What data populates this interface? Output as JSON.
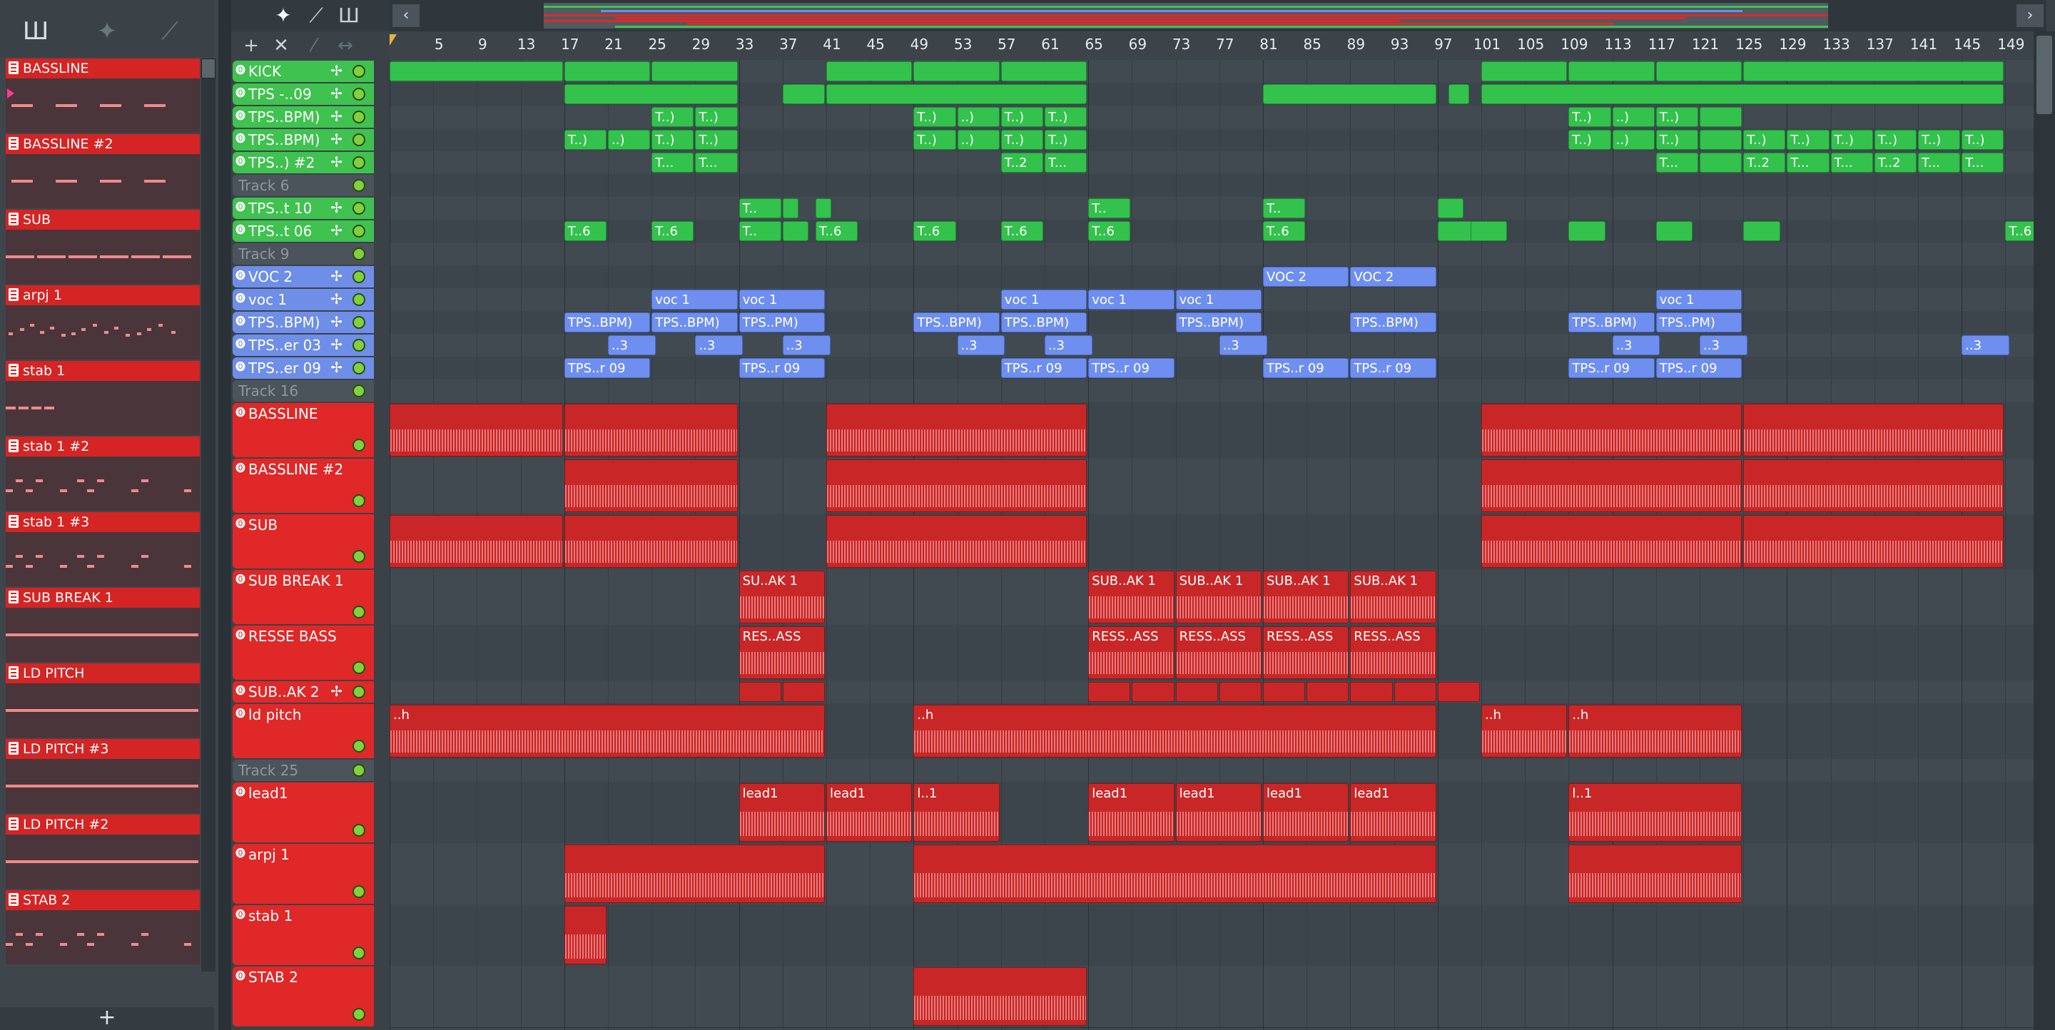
{
  "clip_panel": {
    "clips": [
      {
        "label": "BASSLINE",
        "pattern": "dash-long"
      },
      {
        "label": "BASSLINE #2",
        "pattern": "dash-long"
      },
      {
        "label": "SUB",
        "pattern": "dash-full"
      },
      {
        "label": "arpj 1",
        "pattern": "dots"
      },
      {
        "label": "stab 1",
        "pattern": "dash-short"
      },
      {
        "label": "stab 1 #2",
        "pattern": "dash-mixed"
      },
      {
        "label": "stab 1 #3",
        "pattern": "dash-mixed"
      },
      {
        "label": "SUB BREAK 1",
        "pattern": "line"
      },
      {
        "label": "LD PITCH",
        "pattern": "line"
      },
      {
        "label": "LD PITCH #3",
        "pattern": "line"
      },
      {
        "label": "LD PITCH #2",
        "pattern": "line"
      },
      {
        "label": "STAB 2",
        "pattern": "dash-mixed"
      }
    ],
    "add_label": "+"
  },
  "toolbar": {
    "add": "+",
    "close": "✕"
  },
  "ruler": {
    "bars": [
      "5",
      "9",
      "13",
      "17",
      "21",
      "25",
      "29",
      "33",
      "37",
      "41",
      "45",
      "49",
      "53",
      "57",
      "61",
      "65",
      "69",
      "73",
      "77",
      "81",
      "85",
      "89",
      "93",
      "97",
      "101",
      "105",
      "109",
      "113",
      "117",
      "121",
      "125",
      "129",
      "133",
      "137",
      "141",
      "145",
      "149"
    ]
  },
  "tracks": [
    {
      "label": "KICK",
      "color": "green",
      "h": 32
    },
    {
      "label": "TPS -..09",
      "color": "green",
      "h": 32
    },
    {
      "label": "TPS..BPM)",
      "color": "green",
      "h": 32
    },
    {
      "label": "TPS..BPM)",
      "color": "green",
      "h": 32
    },
    {
      "label": "TPS..) #2",
      "color": "green",
      "h": 32
    },
    {
      "label": "Track 6",
      "color": "empty",
      "h": 32
    },
    {
      "label": "TPS..t 10",
      "color": "green",
      "h": 32
    },
    {
      "label": "TPS..t 06",
      "color": "green",
      "h": 32
    },
    {
      "label": "Track 9",
      "color": "empty",
      "h": 32
    },
    {
      "label": "VOC 2",
      "color": "blue",
      "h": 32
    },
    {
      "label": "voc 1",
      "color": "blue",
      "h": 32
    },
    {
      "label": "TPS..BPM)",
      "color": "blue",
      "h": 32
    },
    {
      "label": "TPS..er 03",
      "color": "blue",
      "h": 32
    },
    {
      "label": "TPS..er 09",
      "color": "blue",
      "h": 32
    },
    {
      "label": "Track 16",
      "color": "empty",
      "h": 32
    },
    {
      "label": "BASSLINE",
      "color": "red",
      "h": 78
    },
    {
      "label": "BASSLINE #2",
      "color": "red",
      "h": 78
    },
    {
      "label": "SUB",
      "color": "red",
      "h": 78
    },
    {
      "label": "SUB BREAK 1",
      "color": "red",
      "h": 78
    },
    {
      "label": "RESSE BASS",
      "color": "red",
      "h": 78
    },
    {
      "label": "SUB..AK 2",
      "color": "red",
      "h": 32
    },
    {
      "label": "ld pitch",
      "color": "red",
      "h": 78
    },
    {
      "label": "Track 25",
      "color": "empty",
      "h": 32
    },
    {
      "label": "lead1",
      "color": "red",
      "h": 86
    },
    {
      "label": "arpj 1",
      "color": "red",
      "h": 86
    },
    {
      "label": "stab 1",
      "color": "red",
      "h": 86
    },
    {
      "label": "STAB 2",
      "color": "red",
      "h": 86
    }
  ],
  "clips": [
    {
      "row": 0,
      "s": 1,
      "e": 16,
      "c": "g",
      "t": ""
    },
    {
      "row": 0,
      "s": 17,
      "e": 24,
      "c": "g",
      "t": ""
    },
    {
      "row": 0,
      "s": 25,
      "e": 32,
      "c": "g",
      "t": ""
    },
    {
      "row": 0,
      "s": 41,
      "e": 48,
      "c": "g",
      "t": ""
    },
    {
      "row": 0,
      "s": 49,
      "e": 56,
      "c": "g",
      "t": ""
    },
    {
      "row": 0,
      "s": 57,
      "e": 64,
      "c": "g",
      "t": ""
    },
    {
      "row": 0,
      "s": 101,
      "e": 108,
      "c": "g",
      "t": ""
    },
    {
      "row": 0,
      "s": 109,
      "e": 116,
      "c": "g",
      "t": ""
    },
    {
      "row": 0,
      "s": 117,
      "e": 124,
      "c": "g",
      "t": ""
    },
    {
      "row": 0,
      "s": 125,
      "e": 148,
      "c": "g",
      "t": ""
    },
    {
      "row": 1,
      "s": 17,
      "e": 32,
      "c": "g",
      "t": ""
    },
    {
      "row": 1,
      "s": 37,
      "e": 40,
      "c": "g",
      "t": ""
    },
    {
      "row": 1,
      "s": 41,
      "e": 64,
      "c": "g",
      "t": ""
    },
    {
      "row": 1,
      "s": 81,
      "e": 96,
      "c": "g",
      "t": ""
    },
    {
      "row": 1,
      "s": 98,
      "e": 99,
      "c": "g",
      "t": ""
    },
    {
      "row": 1,
      "s": 101,
      "e": 148,
      "c": "g",
      "t": ""
    },
    {
      "row": 2,
      "s": 25,
      "e": 28,
      "c": "g",
      "t": "T..)"
    },
    {
      "row": 2,
      "s": 29,
      "e": 32,
      "c": "g",
      "t": "T..)"
    },
    {
      "row": 2,
      "s": 49,
      "e": 52,
      "c": "g",
      "t": "T..)"
    },
    {
      "row": 2,
      "s": 53,
      "e": 56,
      "c": "g",
      "t": "..)"
    },
    {
      "row": 2,
      "s": 57,
      "e": 60,
      "c": "g",
      "t": "T..)"
    },
    {
      "row": 2,
      "s": 61,
      "e": 64,
      "c": "g",
      "t": "T..)"
    },
    {
      "row": 2,
      "s": 109,
      "e": 112,
      "c": "g",
      "t": "T..)"
    },
    {
      "row": 2,
      "s": 113,
      "e": 116,
      "c": "g",
      "t": "..)"
    },
    {
      "row": 2,
      "s": 117,
      "e": 120,
      "c": "g",
      "t": "T..)"
    },
    {
      "row": 2,
      "s": 121,
      "e": 124,
      "c": "g",
      "t": ""
    },
    {
      "row": 3,
      "s": 17,
      "e": 20,
      "c": "g",
      "t": "T..)"
    },
    {
      "row": 3,
      "s": 21,
      "e": 24,
      "c": "g",
      "t": "..)"
    },
    {
      "row": 3,
      "s": 25,
      "e": 28,
      "c": "g",
      "t": "T..)"
    },
    {
      "row": 3,
      "s": 29,
      "e": 32,
      "c": "g",
      "t": "T..)"
    },
    {
      "row": 3,
      "s": 49,
      "e": 52,
      "c": "g",
      "t": "T..)"
    },
    {
      "row": 3,
      "s": 53,
      "e": 56,
      "c": "g",
      "t": "..)"
    },
    {
      "row": 3,
      "s": 57,
      "e": 60,
      "c": "g",
      "t": "T..)"
    },
    {
      "row": 3,
      "s": 61,
      "e": 64,
      "c": "g",
      "t": "T..)"
    },
    {
      "row": 3,
      "s": 109,
      "e": 112,
      "c": "g",
      "t": "T..)"
    },
    {
      "row": 3,
      "s": 113,
      "e": 116,
      "c": "g",
      "t": "..)"
    },
    {
      "row": 3,
      "s": 117,
      "e": 120,
      "c": "g",
      "t": "T..)"
    },
    {
      "row": 3,
      "s": 121,
      "e": 124,
      "c": "g",
      "t": ""
    },
    {
      "row": 3,
      "s": 125,
      "e": 128,
      "c": "g",
      "t": "T..)"
    },
    {
      "row": 3,
      "s": 129,
      "e": 132,
      "c": "g",
      "t": "T..)"
    },
    {
      "row": 3,
      "s": 133,
      "e": 136,
      "c": "g",
      "t": "T..)"
    },
    {
      "row": 3,
      "s": 137,
      "e": 140,
      "c": "g",
      "t": "T..)"
    },
    {
      "row": 3,
      "s": 141,
      "e": 144,
      "c": "g",
      "t": "T..)"
    },
    {
      "row": 3,
      "s": 145,
      "e": 148,
      "c": "g",
      "t": "T..)"
    },
    {
      "row": 4,
      "s": 25,
      "e": 28,
      "c": "g",
      "t": "T..."
    },
    {
      "row": 4,
      "s": 29,
      "e": 32,
      "c": "g",
      "t": "T..."
    },
    {
      "row": 4,
      "s": 57,
      "e": 60,
      "c": "g",
      "t": "T..2"
    },
    {
      "row": 4,
      "s": 61,
      "e": 64,
      "c": "g",
      "t": "T..."
    },
    {
      "row": 4,
      "s": 117,
      "e": 120,
      "c": "g",
      "t": "T..."
    },
    {
      "row": 4,
      "s": 121,
      "e": 124,
      "c": "g",
      "t": ""
    },
    {
      "row": 4,
      "s": 125,
      "e": 128,
      "c": "g",
      "t": "T..2"
    },
    {
      "row": 4,
      "s": 129,
      "e": 132,
      "c": "g",
      "t": "T..."
    },
    {
      "row": 4,
      "s": 133,
      "e": 136,
      "c": "g",
      "t": "T..."
    },
    {
      "row": 4,
      "s": 137,
      "e": 140,
      "c": "g",
      "t": "T..2"
    },
    {
      "row": 4,
      "s": 141,
      "e": 144,
      "c": "g",
      "t": "T..."
    },
    {
      "row": 4,
      "s": 145,
      "e": 148,
      "c": "g",
      "t": "T..."
    },
    {
      "row": 6,
      "s": 33,
      "e": 36,
      "c": "g",
      "t": "T.."
    },
    {
      "row": 6,
      "s": 37,
      "e": 37.6,
      "c": "g",
      "t": ""
    },
    {
      "row": 6,
      "s": 40,
      "e": 40.6,
      "c": "g",
      "t": ""
    },
    {
      "row": 6,
      "s": 65,
      "e": 68,
      "c": "g",
      "t": "T.."
    },
    {
      "row": 6,
      "s": 81,
      "e": 84,
      "c": "g",
      "t": "T.."
    },
    {
      "row": 6,
      "s": 97,
      "e": 98.5,
      "c": "g",
      "t": ""
    },
    {
      "row": 7,
      "s": 17,
      "e": 20,
      "c": "g",
      "t": "T..6"
    },
    {
      "row": 7,
      "s": 25,
      "e": 28,
      "c": "g",
      "t": "T..6"
    },
    {
      "row": 7,
      "s": 33,
      "e": 36,
      "c": "g",
      "t": "T.."
    },
    {
      "row": 7,
      "s": 37,
      "e": 38.5,
      "c": "g",
      "t": ""
    },
    {
      "row": 7,
      "s": 40,
      "e": 43,
      "c": "g",
      "t": "T..6"
    },
    {
      "row": 7,
      "s": 49,
      "e": 52,
      "c": "g",
      "t": "T..6"
    },
    {
      "row": 7,
      "s": 57,
      "e": 60,
      "c": "g",
      "t": "T..6"
    },
    {
      "row": 7,
      "s": 65,
      "e": 68,
      "c": "g",
      "t": "T..6"
    },
    {
      "row": 7,
      "s": 81,
      "e": 84,
      "c": "g",
      "t": "T..6"
    },
    {
      "row": 7,
      "s": 97,
      "e": 99.5,
      "c": "g",
      "t": ""
    },
    {
      "row": 7,
      "s": 100,
      "e": 102.5,
      "c": "g",
      "t": ""
    },
    {
      "row": 7,
      "s": 109,
      "e": 111.5,
      "c": "g",
      "t": ""
    },
    {
      "row": 7,
      "s": 117,
      "e": 119.5,
      "c": "g",
      "t": ""
    },
    {
      "row": 7,
      "s": 125,
      "e": 127.5,
      "c": "g",
      "t": ""
    },
    {
      "row": 7,
      "s": 149,
      "e": 152,
      "c": "g",
      "t": "T..6"
    },
    {
      "row": 9,
      "s": 81,
      "e": 88,
      "c": "b",
      "t": "VOC 2"
    },
    {
      "row": 9,
      "s": 89,
      "e": 96,
      "c": "b",
      "t": "VOC 2"
    },
    {
      "row": 10,
      "s": 25,
      "e": 32,
      "c": "b",
      "t": "voc 1"
    },
    {
      "row": 10,
      "s": 33,
      "e": 40,
      "c": "b",
      "t": "voc 1"
    },
    {
      "row": 10,
      "s": 57,
      "e": 64,
      "c": "b",
      "t": "voc 1"
    },
    {
      "row": 10,
      "s": 65,
      "e": 72,
      "c": "b",
      "t": "voc 1"
    },
    {
      "row": 10,
      "s": 73,
      "e": 80,
      "c": "b",
      "t": "voc 1"
    },
    {
      "row": 10,
      "s": 117,
      "e": 124,
      "c": "b",
      "t": "voc 1"
    },
    {
      "row": 11,
      "s": 17,
      "e": 24,
      "c": "b",
      "t": "TPS..BPM)"
    },
    {
      "row": 11,
      "s": 25,
      "e": 32,
      "c": "b",
      "t": "TPS..BPM)"
    },
    {
      "row": 11,
      "s": 33,
      "e": 40,
      "c": "b",
      "t": "TPS..PM)"
    },
    {
      "row": 11,
      "s": 49,
      "e": 56,
      "c": "b",
      "t": "TPS..BPM)"
    },
    {
      "row": 11,
      "s": 57,
      "e": 64,
      "c": "b",
      "t": "TPS..BPM)"
    },
    {
      "row": 11,
      "s": 73,
      "e": 80,
      "c": "b",
      "t": "TPS..BPM)"
    },
    {
      "row": 11,
      "s": 89,
      "e": 96,
      "c": "b",
      "t": "TPS..BPM)"
    },
    {
      "row": 11,
      "s": 109,
      "e": 116,
      "c": "b",
      "t": "TPS..BPM)"
    },
    {
      "row": 11,
      "s": 117,
      "e": 124,
      "c": "b",
      "t": "TPS..PM)"
    },
    {
      "row": 12,
      "s": 21,
      "e": 24.5,
      "c": "b",
      "t": "..3"
    },
    {
      "row": 12,
      "s": 29,
      "e": 32.5,
      "c": "b",
      "t": "..3"
    },
    {
      "row": 12,
      "s": 37,
      "e": 40.5,
      "c": "b",
      "t": "..3"
    },
    {
      "row": 12,
      "s": 53,
      "e": 56.5,
      "c": "b",
      "t": "..3"
    },
    {
      "row": 12,
      "s": 61,
      "e": 64.5,
      "c": "b",
      "t": "..3"
    },
    {
      "row": 12,
      "s": 77,
      "e": 80.5,
      "c": "b",
      "t": "..3"
    },
    {
      "row": 12,
      "s": 113,
      "e": 116.5,
      "c": "b",
      "t": "..3"
    },
    {
      "row": 12,
      "s": 121,
      "e": 124.5,
      "c": "b",
      "t": "..3"
    },
    {
      "row": 12,
      "s": 145,
      "e": 148.5,
      "c": "b",
      "t": "..3"
    },
    {
      "row": 13,
      "s": 17,
      "e": 24,
      "c": "b",
      "t": "TPS..r 09"
    },
    {
      "row": 13,
      "s": 33,
      "e": 40,
      "c": "b",
      "t": "TPS..r 09"
    },
    {
      "row": 13,
      "s": 57,
      "e": 64,
      "c": "b",
      "t": "TPS..r 09"
    },
    {
      "row": 13,
      "s": 65,
      "e": 72,
      "c": "b",
      "t": "TPS..r 09"
    },
    {
      "row": 13,
      "s": 81,
      "e": 88,
      "c": "b",
      "t": "TPS..r 09"
    },
    {
      "row": 13,
      "s": 89,
      "e": 96,
      "c": "b",
      "t": "TPS..r 09"
    },
    {
      "row": 13,
      "s": 109,
      "e": 116,
      "c": "b",
      "t": "TPS..r 09"
    },
    {
      "row": 13,
      "s": 117,
      "e": 124,
      "c": "b",
      "t": "TPS..r 09"
    },
    {
      "row": 15,
      "s": 1,
      "e": 16,
      "c": "r",
      "t": ""
    },
    {
      "row": 15,
      "s": 17,
      "e": 32,
      "c": "r",
      "t": ""
    },
    {
      "row": 15,
      "s": 41,
      "e": 64,
      "c": "r",
      "t": ""
    },
    {
      "row": 15,
      "s": 101,
      "e": 124,
      "c": "r",
      "t": ""
    },
    {
      "row": 15,
      "s": 125,
      "e": 148,
      "c": "r",
      "t": ""
    },
    {
      "row": 16,
      "s": 17,
      "e": 32,
      "c": "r",
      "t": ""
    },
    {
      "row": 16,
      "s": 41,
      "e": 64,
      "c": "r",
      "t": ""
    },
    {
      "row": 16,
      "s": 101,
      "e": 124,
      "c": "r",
      "t": ""
    },
    {
      "row": 16,
      "s": 125,
      "e": 148,
      "c": "r",
      "t": ""
    },
    {
      "row": 17,
      "s": 1,
      "e": 16,
      "c": "r",
      "t": ""
    },
    {
      "row": 17,
      "s": 17,
      "e": 32,
      "c": "r",
      "t": ""
    },
    {
      "row": 17,
      "s": 41,
      "e": 64,
      "c": "r",
      "t": ""
    },
    {
      "row": 17,
      "s": 101,
      "e": 124,
      "c": "r",
      "t": ""
    },
    {
      "row": 17,
      "s": 125,
      "e": 148,
      "c": "r",
      "t": ""
    },
    {
      "row": 18,
      "s": 33,
      "e": 40,
      "c": "r",
      "t": "SU..AK 1"
    },
    {
      "row": 18,
      "s": 65,
      "e": 72,
      "c": "r",
      "t": "SUB..AK 1"
    },
    {
      "row": 18,
      "s": 73,
      "e": 80,
      "c": "r",
      "t": "SUB..AK 1"
    },
    {
      "row": 18,
      "s": 81,
      "e": 88,
      "c": "r",
      "t": "SUB..AK 1"
    },
    {
      "row": 18,
      "s": 89,
      "e": 96,
      "c": "r",
      "t": "SUB..AK 1"
    },
    {
      "row": 19,
      "s": 33,
      "e": 40,
      "c": "r",
      "t": "RES..ASS"
    },
    {
      "row": 19,
      "s": 65,
      "e": 72,
      "c": "r",
      "t": "RESS..ASS"
    },
    {
      "row": 19,
      "s": 73,
      "e": 80,
      "c": "r",
      "t": "RESS..ASS"
    },
    {
      "row": 19,
      "s": 81,
      "e": 88,
      "c": "r",
      "t": "RESS..ASS"
    },
    {
      "row": 19,
      "s": 89,
      "e": 96,
      "c": "r",
      "t": "RESS..ASS"
    },
    {
      "row": 20,
      "s": 33,
      "e": 36,
      "c": "r",
      "t": ""
    },
    {
      "row": 20,
      "s": 37,
      "e": 40,
      "c": "r",
      "t": ""
    },
    {
      "row": 20,
      "s": 65,
      "e": 68,
      "c": "r",
      "t": ""
    },
    {
      "row": 20,
      "s": 69,
      "e": 72,
      "c": "r",
      "t": ""
    },
    {
      "row": 20,
      "s": 73,
      "e": 76,
      "c": "r",
      "t": ""
    },
    {
      "row": 20,
      "s": 77,
      "e": 80,
      "c": "r",
      "t": ""
    },
    {
      "row": 20,
      "s": 81,
      "e": 84,
      "c": "r",
      "t": ""
    },
    {
      "row": 20,
      "s": 85,
      "e": 88,
      "c": "r",
      "t": ""
    },
    {
      "row": 20,
      "s": 89,
      "e": 92,
      "c": "r",
      "t": ""
    },
    {
      "row": 20,
      "s": 93,
      "e": 96,
      "c": "r",
      "t": ""
    },
    {
      "row": 20,
      "s": 97,
      "e": 100,
      "c": "r",
      "t": ""
    },
    {
      "row": 21,
      "s": 1,
      "e": 40,
      "c": "r",
      "t": "..h"
    },
    {
      "row": 21,
      "s": 49,
      "e": 96,
      "c": "r",
      "t": "..h"
    },
    {
      "row": 21,
      "s": 101,
      "e": 108,
      "c": "r",
      "t": "..h"
    },
    {
      "row": 21,
      "s": 109,
      "e": 124,
      "c": "r",
      "t": "..h"
    },
    {
      "row": 23,
      "s": 33,
      "e": 40,
      "c": "r",
      "t": "lead1"
    },
    {
      "row": 23,
      "s": 41,
      "e": 48,
      "c": "r",
      "t": "lead1"
    },
    {
      "row": 23,
      "s": 49,
      "e": 56,
      "c": "r",
      "t": "l..1"
    },
    {
      "row": 23,
      "s": 65,
      "e": 72,
      "c": "r",
      "t": "lead1"
    },
    {
      "row": 23,
      "s": 73,
      "e": 80,
      "c": "r",
      "t": "lead1"
    },
    {
      "row": 23,
      "s": 81,
      "e": 88,
      "c": "r",
      "t": "lead1"
    },
    {
      "row": 23,
      "s": 89,
      "e": 96,
      "c": "r",
      "t": "lead1"
    },
    {
      "row": 23,
      "s": 109,
      "e": 124,
      "c": "r",
      "t": "l..1"
    },
    {
      "row": 24,
      "s": 17,
      "e": 40,
      "c": "r",
      "t": ""
    },
    {
      "row": 24,
      "s": 49,
      "e": 96,
      "c": "r",
      "t": ""
    },
    {
      "row": 24,
      "s": 109,
      "e": 124,
      "c": "r",
      "t": ""
    },
    {
      "row": 25,
      "s": 17,
      "e": 20,
      "c": "r",
      "t": ""
    },
    {
      "row": 26,
      "s": 49,
      "e": 64,
      "c": "r",
      "t": ""
    }
  ],
  "colors": {
    "green": "#3fc24f",
    "blue": "#6e8ee8",
    "red": "#e02828",
    "waveform": "#f08a8a"
  }
}
